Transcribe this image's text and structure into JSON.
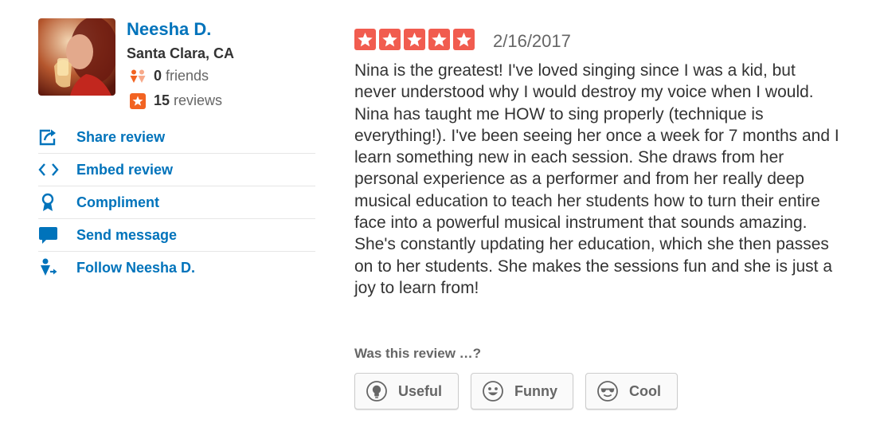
{
  "user": {
    "name": "Neesha D.",
    "location": "Santa Clara, CA",
    "friends_count": "0",
    "friends_label": "friends",
    "reviews_count": "15",
    "reviews_label": "reviews"
  },
  "actions": [
    {
      "label": "Share review",
      "icon": "share-icon"
    },
    {
      "label": "Embed review",
      "icon": "embed-icon"
    },
    {
      "label": "Compliment",
      "icon": "compliment-icon"
    },
    {
      "label": "Send message",
      "icon": "message-icon"
    },
    {
      "label": "Follow Neesha D.",
      "icon": "follow-icon"
    }
  ],
  "review": {
    "rating": 5,
    "date": "2/16/2017",
    "text": "Nina is the greatest! I've loved singing since I was a kid, but never understood why I would destroy my voice when I would. Nina has taught me HOW to sing properly (technique is everything!). I've been seeing her once a week for 7 months and I learn something new in each session. She draws from her personal experience as a performer and from her really deep musical education to teach her students how to turn their entire face into a powerful musical instrument that sounds amazing. She's constantly updating her education, which she then passes on to her students. She makes the sessions fun and she is just a joy to learn from!"
  },
  "feedback": {
    "question": "Was this review …?",
    "buttons": [
      {
        "label": "Useful",
        "icon": "lightbulb-icon"
      },
      {
        "label": "Funny",
        "icon": "smiley-icon"
      },
      {
        "label": "Cool",
        "icon": "sunglasses-icon"
      }
    ]
  },
  "colors": {
    "link": "#0073bb",
    "star": "#f15c4f",
    "friends_icon": "#f26322",
    "reviews_icon": "#f26322",
    "text": "#333333",
    "muted": "#666666"
  }
}
